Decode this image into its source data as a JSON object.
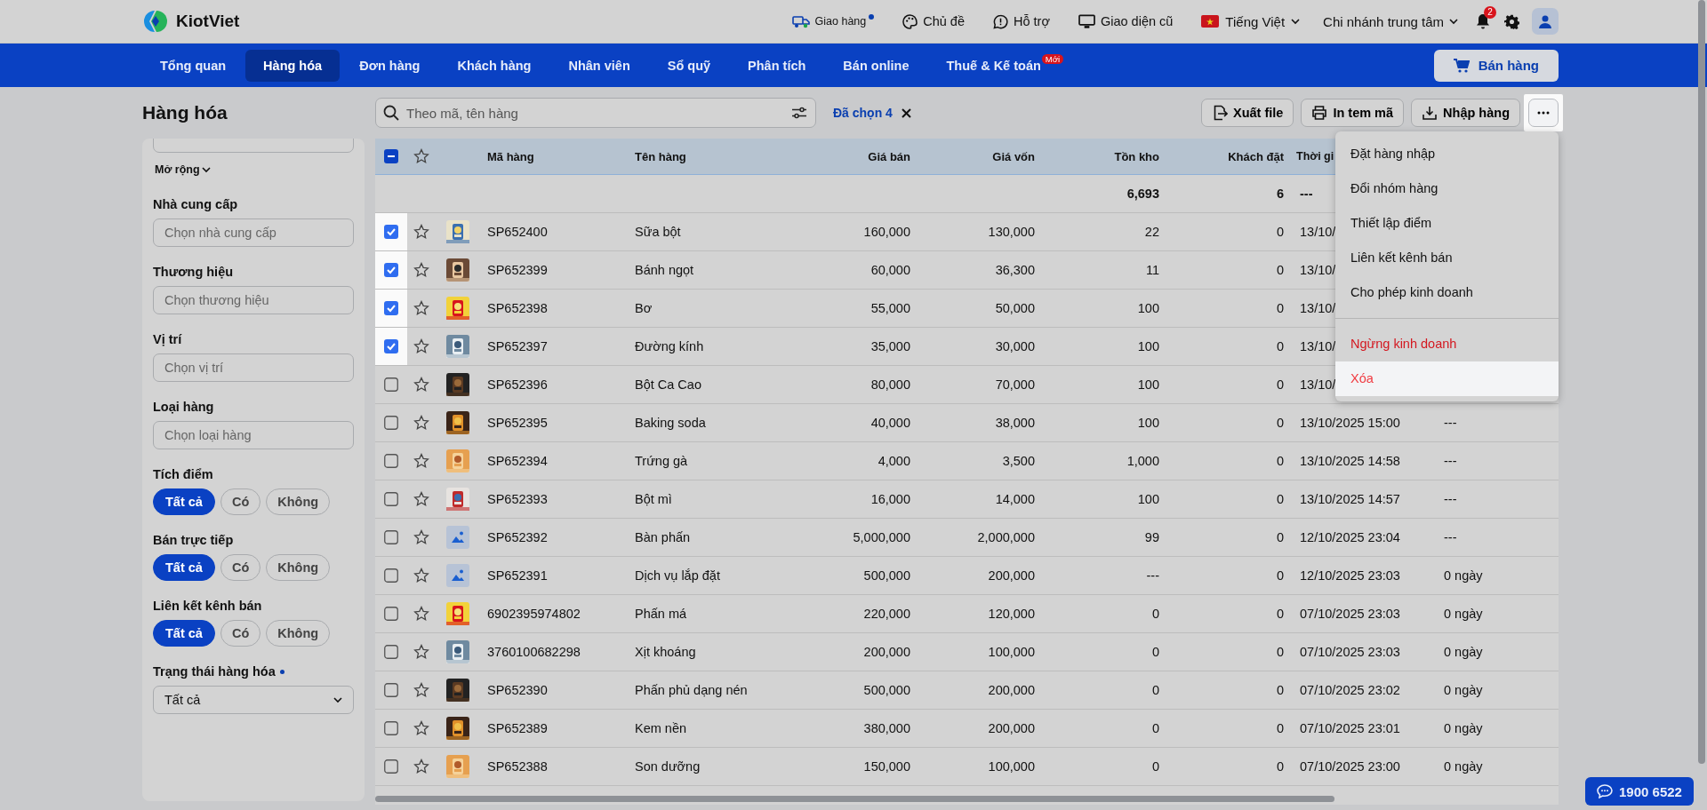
{
  "topbar": {
    "logo": "KiotViet",
    "links": [
      {
        "kind": "delivery",
        "label": "Giao hàng",
        "dot": true
      },
      {
        "kind": "theme",
        "label": "Chủ đề",
        "dot": false
      },
      {
        "kind": "support",
        "label": "Hỗ trợ",
        "dot": false
      },
      {
        "kind": "classic",
        "label": "Giao diện cũ",
        "dot": false
      }
    ],
    "language": "Tiếng Việt",
    "branch": "Chi nhánh trung tâm",
    "notifications": "2"
  },
  "nav": {
    "tabs": [
      {
        "label": "Tổng quan",
        "selected": false
      },
      {
        "label": "Hàng hóa",
        "selected": true
      },
      {
        "label": "Đơn hàng",
        "selected": false
      },
      {
        "label": "Khách hàng",
        "selected": false
      },
      {
        "label": "Nhân viên",
        "selected": false
      },
      {
        "label": "Sổ quỹ",
        "selected": false
      },
      {
        "label": "Phân tích",
        "selected": false
      },
      {
        "label": "Bán online",
        "selected": false
      },
      {
        "label": "Thuế & Kế toán",
        "selected": false,
        "badge": "Mới"
      }
    ],
    "sell_button": "Bán hàng"
  },
  "page_title": "Hàng hóa",
  "sidebar": {
    "sections": [
      {
        "kind": "field"
      },
      {
        "kind": "expand",
        "label": "Mở rộng"
      },
      {
        "kind": "field",
        "label": "Nhà cung cấp",
        "placeholder": "Chọn nhà cung cấp"
      },
      {
        "kind": "field",
        "label": "Thương hiệu",
        "placeholder": "Chọn thương hiệu"
      },
      {
        "kind": "field",
        "label": "Vị trí",
        "placeholder": "Chọn vị trí"
      },
      {
        "kind": "field",
        "label": "Loại hàng",
        "placeholder": "Chọn loại hàng"
      },
      {
        "kind": "pills",
        "label": "Tích điểm",
        "options": [
          {
            "label": "Tất cả",
            "selected": true
          },
          {
            "label": "Có",
            "selected": false
          },
          {
            "label": "Không",
            "selected": false
          }
        ]
      },
      {
        "kind": "pills",
        "label": "Bán trực tiếp",
        "options": [
          {
            "label": "Tất cả",
            "selected": true
          },
          {
            "label": "Có",
            "selected": false
          },
          {
            "label": "Không",
            "selected": false
          }
        ]
      },
      {
        "kind": "pills",
        "label": "Liên kết kênh bán",
        "options": [
          {
            "label": "Tất cả",
            "selected": true
          },
          {
            "label": "Có",
            "selected": false
          },
          {
            "label": "Không",
            "selected": false
          }
        ]
      },
      {
        "kind": "select",
        "label": "Trạng thái hàng hóa",
        "dot": true,
        "value": "Tất cả"
      }
    ]
  },
  "toolbar": {
    "search": {
      "placeholder": "Theo mã, tên hàng"
    },
    "selection": "Đã chọn 4",
    "buttons": [
      {
        "kind": "export",
        "label": "Xuất file"
      },
      {
        "kind": "print",
        "label": "In tem mã"
      },
      {
        "kind": "import",
        "label": "Nhập hàng"
      }
    ]
  },
  "more_menu": {
    "items": [
      {
        "label": "Đặt hàng nhập",
        "kind": "normal",
        "highlighted": false
      },
      {
        "label": "Đổi nhóm hàng",
        "kind": "normal",
        "highlighted": false
      },
      {
        "label": "Thiết lập điểm",
        "kind": "normal",
        "highlighted": false
      },
      {
        "label": "Liên kết kênh bán",
        "kind": "normal",
        "highlighted": false
      },
      {
        "label": "Cho phép kinh doanh",
        "kind": "normal",
        "highlighted": false
      },
      {
        "label": "Ngừng kinh doanh",
        "kind": "danger",
        "highlighted": false
      },
      {
        "label": "Xóa",
        "kind": "danger",
        "highlighted": true
      }
    ]
  },
  "table": {
    "select_all_indeterminate": true,
    "columns": [
      "Mã hàng",
      "Tên hàng",
      "Giá bán",
      "Giá vốn",
      "Tồn kho",
      "Khách đặt",
      "Thời gi"
    ],
    "summary": {
      "stock": "6,693",
      "ordered": "6",
      "time": "---"
    },
    "rows": [
      {
        "checked": true,
        "cells": [
          "SP652400",
          "Sữa bột",
          "160,000",
          "130,000",
          "22",
          "0",
          "13/10/"
        ]
      },
      {
        "checked": true,
        "cells": [
          "SP652399",
          "Bánh ngọt",
          "60,000",
          "36,300",
          "11",
          "0",
          "13/10/"
        ]
      },
      {
        "checked": true,
        "cells": [
          "SP652398",
          "Bơ",
          "55,000",
          "50,000",
          "100",
          "0",
          "13/10/"
        ]
      },
      {
        "checked": true,
        "cells": [
          "SP652397",
          "Đường kính",
          "35,000",
          "30,000",
          "100",
          "0",
          "13/10/"
        ]
      },
      {
        "checked": false,
        "cells": [
          "SP652396",
          "Bột Ca Cao",
          "80,000",
          "70,000",
          "100",
          "0",
          "13/10/"
        ]
      },
      {
        "checked": false,
        "cells": [
          "SP652395",
          "Baking soda",
          "40,000",
          "38,000",
          "100",
          "0",
          "13/10/2025 15:00",
          "---"
        ]
      },
      {
        "checked": false,
        "cells": [
          "SP652394",
          "Trứng gà",
          "4,000",
          "3,500",
          "1,000",
          "0",
          "13/10/2025 14:58",
          "---"
        ]
      },
      {
        "checked": false,
        "cells": [
          "SP652393",
          "Bột mì",
          "16,000",
          "14,000",
          "100",
          "0",
          "13/10/2025 14:57",
          "---"
        ]
      },
      {
        "checked": false,
        "kind": "placeholder",
        "cells": [
          "SP652392",
          "Bàn phấn",
          "5,000,000",
          "2,000,000",
          "99",
          "0",
          "12/10/2025 23:04",
          "---"
        ]
      },
      {
        "checked": false,
        "kind": "placeholder",
        "cells": [
          "SP652391",
          "Dịch vụ lắp đặt",
          "500,000",
          "200,000",
          "---",
          "0",
          "12/10/2025 23:03",
          "0 ngày"
        ]
      },
      {
        "checked": false,
        "cells": [
          "6902395974802",
          "Phấn má",
          "220,000",
          "120,000",
          "0",
          "0",
          "07/10/2025 23:03",
          "0 ngày"
        ]
      },
      {
        "checked": false,
        "cells": [
          "3760100682298",
          "Xịt khoáng",
          "200,000",
          "100,000",
          "0",
          "0",
          "07/10/2025 23:03",
          "0 ngày"
        ]
      },
      {
        "checked": false,
        "cells": [
          "SP652390",
          "Phấn phủ dạng nén",
          "500,000",
          "200,000",
          "0",
          "0",
          "07/10/2025 23:02",
          "0 ngày"
        ]
      },
      {
        "checked": false,
        "cells": [
          "SP652389",
          "Kem nền",
          "380,000",
          "200,000",
          "0",
          "0",
          "07/10/2025 23:01",
          "0 ngày"
        ]
      },
      {
        "checked": false,
        "cells": [
          "SP652388",
          "Son dưỡng",
          "150,000",
          "100,000",
          "0",
          "0",
          "07/10/2025 23:00",
          "0 ngày"
        ]
      }
    ]
  },
  "hotline": "1900 6522"
}
